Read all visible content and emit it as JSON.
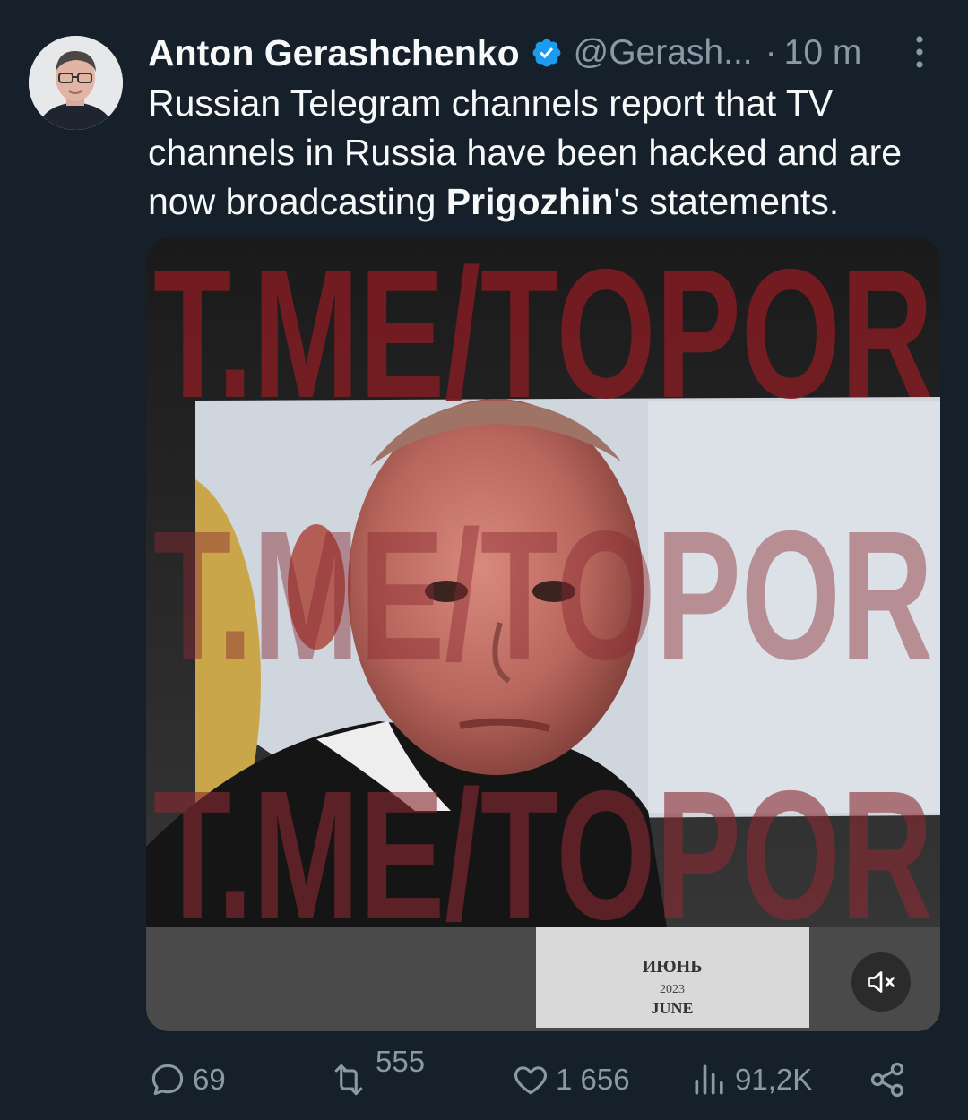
{
  "author": {
    "name": "Anton Gerashchenko",
    "handle": "@Gerash...",
    "separator": "·",
    "time": "10 m",
    "verified_color": "#1d9bf0"
  },
  "tweet": {
    "text_part1": "Russian Telegram channels report that TV channels in Russia have been hacked and are now broadcasting ",
    "text_bold": "Prigozhin",
    "text_part2": "'s statements."
  },
  "media": {
    "watermark": "T.ME/TOPOR",
    "calendar_line1": "ИЮНЬ",
    "calendar_line2": "2023",
    "calendar_line3": "JUNE",
    "mute_icon": "speaker-muted-icon"
  },
  "actions": {
    "replies": "69",
    "reposts": "555",
    "likes": "1 656",
    "views": "91,2K"
  },
  "colors": {
    "background": "#15202b",
    "text": "#f7f9f9",
    "muted": "#8b98a5",
    "accent": "#1d9bf0"
  }
}
